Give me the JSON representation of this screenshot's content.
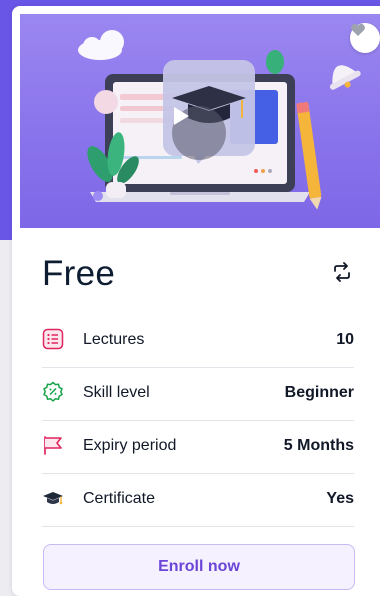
{
  "course": {
    "price": "Free",
    "details": [
      {
        "icon": "lectures-list-icon",
        "label": "Lectures",
        "value": "10",
        "color": "#e0245e"
      },
      {
        "icon": "skill-badge-icon",
        "label": "Skill level",
        "value": "Beginner",
        "color": "#16a34a"
      },
      {
        "icon": "flag-icon",
        "label": "Expiry period",
        "value": "5 Months",
        "color": "#e0245e"
      },
      {
        "icon": "graduation-cap-icon",
        "label": "Certificate",
        "value": "Yes",
        "color": "#1f2937"
      }
    ],
    "enroll_label": "Enroll now"
  },
  "colors": {
    "accent": "#6b46d8",
    "hero_bg": "#8a74ec",
    "page_bg_strip": "#6a56e6"
  },
  "icons": {
    "hero_actions": [
      "heart-icon",
      "play-icon"
    ],
    "share": "repeat-share-icon"
  }
}
